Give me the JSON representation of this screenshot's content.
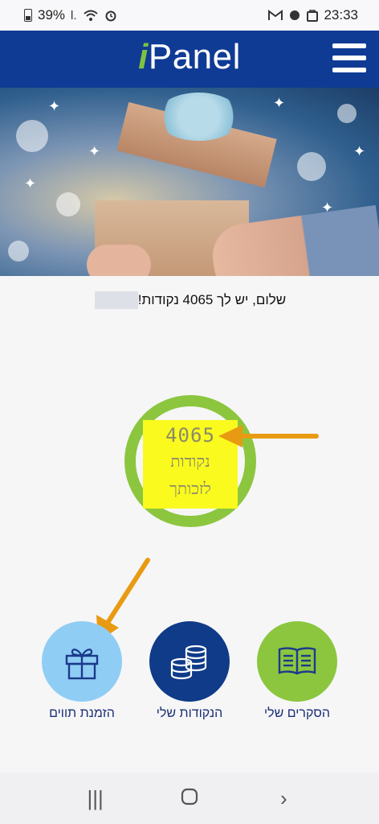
{
  "status_bar": {
    "battery": "39%",
    "time": "23:33",
    "signal_label": "l."
  },
  "header": {
    "logo_i": "i",
    "logo_text": "Panel"
  },
  "greeting": {
    "text": "שלום, יש לך 4065 נקודות!"
  },
  "points": {
    "value": "4065",
    "line1": "נקודות",
    "line2": "לזכותך"
  },
  "actions": [
    {
      "label": "הזמנת תווים",
      "icon": "gift-icon",
      "color": "#90cdf4"
    },
    {
      "label": "הנקודות שלי",
      "icon": "coins-icon",
      "color": "#0f3b88"
    },
    {
      "label": "הסקרים שלי",
      "icon": "open-book-icon",
      "color": "#8cc63f"
    }
  ],
  "nav": {
    "recents": "|||",
    "back": "›"
  },
  "colors": {
    "brand_blue": "#0f3b95",
    "brand_green": "#8cc63f",
    "highlight_yellow": "#fafa1e",
    "arrow_orange": "#e89b12"
  }
}
